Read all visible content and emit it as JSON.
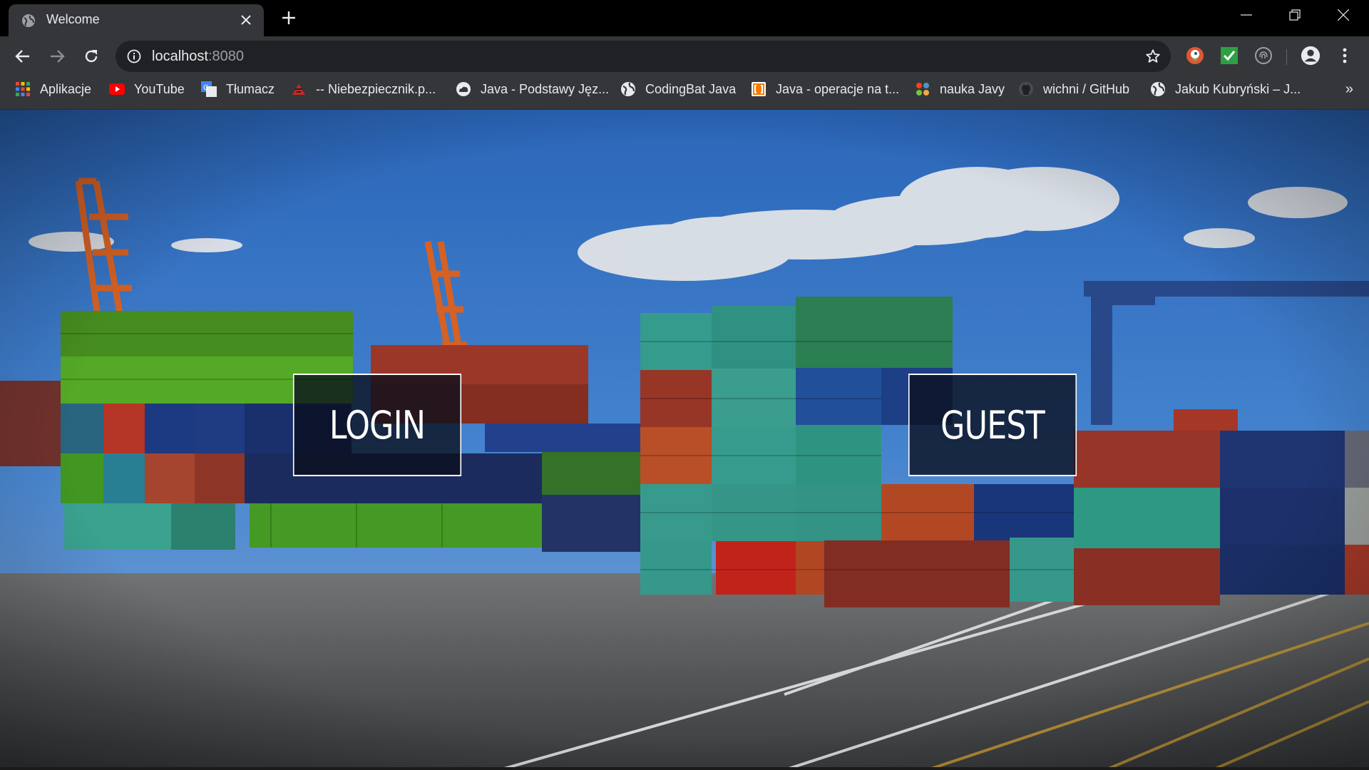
{
  "browser": {
    "tab_title": "Welcome",
    "url_host": "localhost",
    "url_port": ":8080"
  },
  "bookmarks": [
    {
      "label": "Aplikacje",
      "icon": "apps-grid-icon"
    },
    {
      "label": "YouTube",
      "icon": "youtube-icon"
    },
    {
      "label": "Tłumacz",
      "icon": "translate-icon"
    },
    {
      "label": "-- Niebezpiecznik.p...",
      "icon": "niebezpiecznik-icon"
    },
    {
      "label": "Java - Podstawy Jęz...",
      "icon": "cloud-icon"
    },
    {
      "label": "CodingBat Java",
      "icon": "globe-icon"
    },
    {
      "label": "Java - operacje na t...",
      "icon": "bracket-icon"
    },
    {
      "label": "nauka Javy",
      "icon": "joomla-icon"
    },
    {
      "label": "wichni / GitHub",
      "icon": "github-icon"
    },
    {
      "label": "Jakub Kubryński – J...",
      "icon": "globe-icon"
    }
  ],
  "page": {
    "login_label": "LOGIN",
    "guest_label": "GUEST"
  },
  "colors": {
    "tab_bg": "#35363a",
    "frame_bg": "#000000",
    "omnibox_bg": "#202124",
    "text": "#e8eaed",
    "button_border": "#ffffff"
  }
}
